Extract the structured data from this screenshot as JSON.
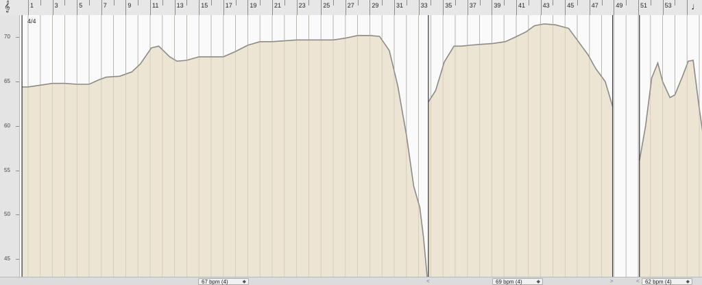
{
  "ruler": {
    "bar_labels": [
      "1",
      "3",
      "5",
      "7",
      "9",
      "11",
      "13",
      "15",
      "17",
      "19",
      "21",
      "23",
      "25",
      "27",
      "29",
      "31",
      "33",
      "35",
      "37",
      "39",
      "41",
      "43",
      "45",
      "47",
      "49",
      "51",
      "53"
    ],
    "clef_icon": "treble-clef-icon",
    "end_icon": "note-icon"
  },
  "time_signature": "4/4",
  "y_axis": {
    "labels": [
      "70",
      "65",
      "60",
      "55",
      "50",
      "45"
    ]
  },
  "tempo_regions": [
    {
      "label": "67 bpm",
      "detail": "(4)",
      "stepper": "◆"
    },
    {
      "label": "69 bpm",
      "detail": "(4)",
      "stepper": "◆"
    },
    {
      "label": "62 bpm",
      "detail": "(4)",
      "stepper": "◆"
    }
  ],
  "region_markers": [
    "<",
    ">",
    "<"
  ],
  "colors": {
    "fill": "#ebe3d0",
    "curve": "#8a8a8a",
    "bar_line": "#a8a8a8",
    "region_line": "#333333"
  },
  "chart_data": {
    "type": "area",
    "xlabel": "",
    "ylabel": "",
    "x_unit": "bar",
    "y_unit": "bpm",
    "xlim": [
      0.5,
      54.3
    ],
    "ylim": [
      43,
      73
    ],
    "grid": true,
    "region_breaks": [
      33.8,
      48.9,
      51.1
    ],
    "series": [
      {
        "name": "",
        "points": [
          [
            0.5,
            64.4
          ],
          [
            1,
            64.4
          ],
          [
            2,
            64.6
          ],
          [
            3,
            64.8
          ],
          [
            4,
            64.8
          ],
          [
            5,
            64.7
          ],
          [
            6,
            64.7
          ],
          [
            6.8,
            65.2
          ],
          [
            7.4,
            65.5
          ],
          [
            8.5,
            65.6
          ],
          [
            9.5,
            66.1
          ],
          [
            10.2,
            67.0
          ],
          [
            11.1,
            68.8
          ],
          [
            11.7,
            69.0
          ],
          [
            12.6,
            67.8
          ],
          [
            13.2,
            67.3
          ],
          [
            14.0,
            67.4
          ],
          [
            15.0,
            67.8
          ],
          [
            16.0,
            67.8
          ],
          [
            17.0,
            67.8
          ],
          [
            18.0,
            68.4
          ],
          [
            19.0,
            69.1
          ],
          [
            20.0,
            69.5
          ],
          [
            21.0,
            69.5
          ],
          [
            22.0,
            69.6
          ],
          [
            23.0,
            69.7
          ],
          [
            24.0,
            69.7
          ],
          [
            25.0,
            69.7
          ],
          [
            26.0,
            69.7
          ],
          [
            27.0,
            69.9
          ],
          [
            28.0,
            70.2
          ],
          [
            29.0,
            70.2
          ],
          [
            29.8,
            70.1
          ],
          [
            30.6,
            68.5
          ],
          [
            31.3,
            64.5
          ],
          [
            32.0,
            59.0
          ],
          [
            32.6,
            53.2
          ],
          [
            33.1,
            50.8
          ],
          [
            33.4,
            47.5
          ],
          [
            33.7,
            43.0
          ]
        ]
      },
      {
        "name": "",
        "points": [
          [
            33.8,
            62.7
          ],
          [
            34.4,
            64.0
          ],
          [
            35.1,
            67.2
          ],
          [
            35.9,
            69.0
          ],
          [
            36.5,
            69.0
          ],
          [
            37.2,
            69.1
          ],
          [
            38.1,
            69.2
          ],
          [
            39.1,
            69.3
          ],
          [
            40.1,
            69.5
          ],
          [
            40.9,
            70.0
          ],
          [
            41.8,
            70.6
          ],
          [
            42.5,
            71.3
          ],
          [
            43.3,
            71.5
          ],
          [
            44.2,
            71.4
          ],
          [
            45.3,
            71.0
          ],
          [
            46.1,
            69.5
          ],
          [
            46.9,
            68.0
          ],
          [
            47.5,
            66.5
          ],
          [
            48.3,
            65.0
          ],
          [
            48.9,
            62.2
          ]
        ]
      },
      {
        "name": "",
        "points": [
          [
            51.1,
            56.1
          ],
          [
            51.6,
            60.0
          ],
          [
            52.1,
            65.4
          ],
          [
            52.6,
            67.1
          ],
          [
            53.0,
            65.0
          ],
          [
            53.6,
            63.2
          ],
          [
            54.0,
            63.5
          ],
          [
            54.6,
            65.5
          ],
          [
            55.1,
            67.3
          ],
          [
            55.5,
            67.4
          ],
          [
            56.0,
            62.0
          ],
          [
            56.5,
            57.2
          ],
          [
            57.0,
            54.6
          ],
          [
            57.5,
            52.8
          ],
          [
            57.9,
            53.0
          ],
          [
            58.3,
            55.5
          ]
        ]
      }
    ],
    "bar_range": [
      0.5,
      58.5
    ]
  }
}
